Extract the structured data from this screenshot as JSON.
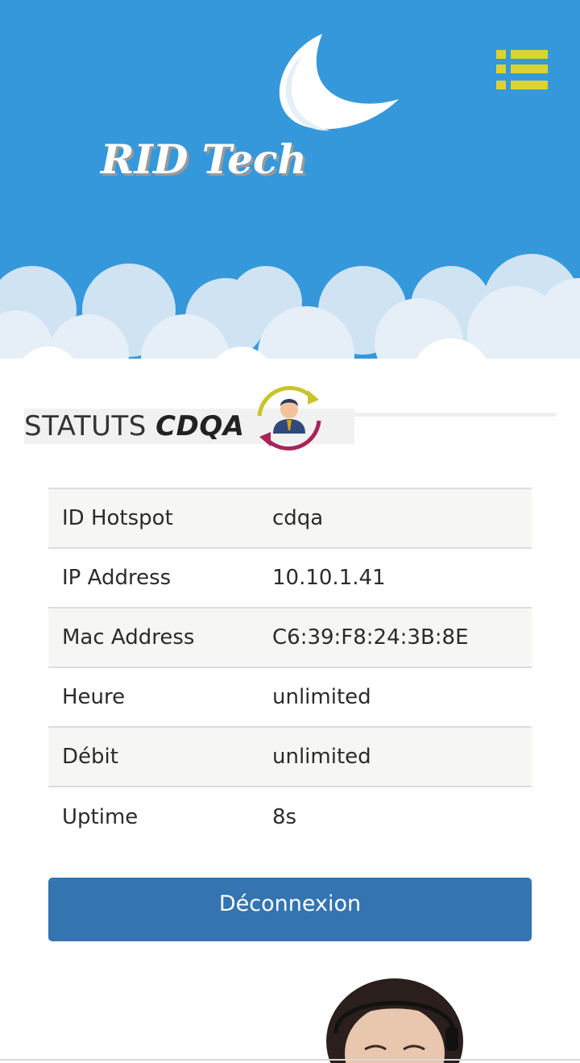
{
  "header": {
    "logo_text": "RID Tech",
    "menu_icon": "list-menu-icon"
  },
  "status": {
    "label": "STATUTS",
    "username": "CDQA",
    "icon": "user-refresh-icon"
  },
  "info_table": {
    "rows": [
      {
        "label": "ID Hotspot",
        "value": "cdqa"
      },
      {
        "label": "IP Address",
        "value": "10.10.1.41"
      },
      {
        "label": "Mac Address",
        "value": "C6:39:F8:24:3B:8E"
      },
      {
        "label": "Heure",
        "value": "unlimited"
      },
      {
        "label": "Débit",
        "value": "unlimited"
      },
      {
        "label": "Uptime",
        "value": "8s"
      }
    ]
  },
  "logout_button": {
    "label": "Déconnexion"
  },
  "colors": {
    "header_blue": "#3598db",
    "button_blue": "#3374b1",
    "menu_yellow": "#d9d52e"
  }
}
